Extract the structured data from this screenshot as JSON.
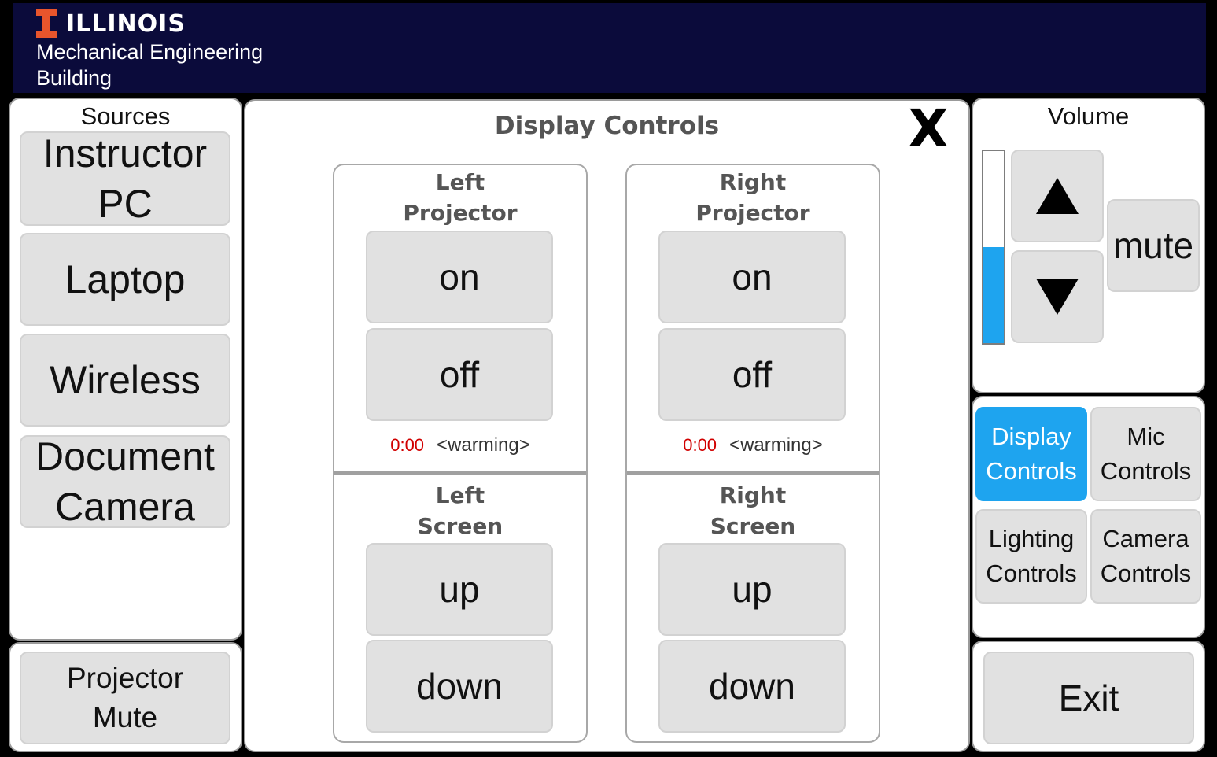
{
  "header": {
    "brand": "ILLINOIS",
    "subtitle": "Mechanical Engineering\nBuilding"
  },
  "sources": {
    "title": "Sources",
    "items": [
      {
        "label": "Instructor\nPC"
      },
      {
        "label": "Laptop"
      },
      {
        "label": "Wireless"
      },
      {
        "label": "Document\nCamera"
      }
    ]
  },
  "projector_mute": {
    "label": "Projector\nMute"
  },
  "display_controls": {
    "title": "Display Controls",
    "close_label": "X",
    "left_projector": {
      "title": "Left\nProjector",
      "on_label": "on",
      "off_label": "off",
      "timer": "0:00",
      "status": "<warming>"
    },
    "right_projector": {
      "title": "Right\nProjector",
      "on_label": "on",
      "off_label": "off",
      "timer": "0:00",
      "status": "<warming>"
    },
    "left_screen": {
      "title": "Left\nScreen",
      "up_label": "up",
      "down_label": "down"
    },
    "right_screen": {
      "title": "Right\nScreen",
      "up_label": "up",
      "down_label": "down"
    }
  },
  "volume": {
    "title": "Volume",
    "level_percent": 50,
    "mute_label": "mute",
    "up_icon": "triangle-up-icon",
    "down_icon": "triangle-down-icon"
  },
  "nav": {
    "items": [
      {
        "label": "Display\nControls",
        "active": true
      },
      {
        "label": "Mic\nControls",
        "active": false
      },
      {
        "label": "Lighting\nControls",
        "active": false
      },
      {
        "label": "Camera\nControls",
        "active": false
      }
    ]
  },
  "exit": {
    "label": "Exit"
  },
  "colors": {
    "header_bg": "#0b0b3b",
    "illinois_orange": "#e8552c",
    "active_blue": "#1ea4ef",
    "button_gray": "#e1e1e1",
    "timer_red": "#d10000"
  }
}
